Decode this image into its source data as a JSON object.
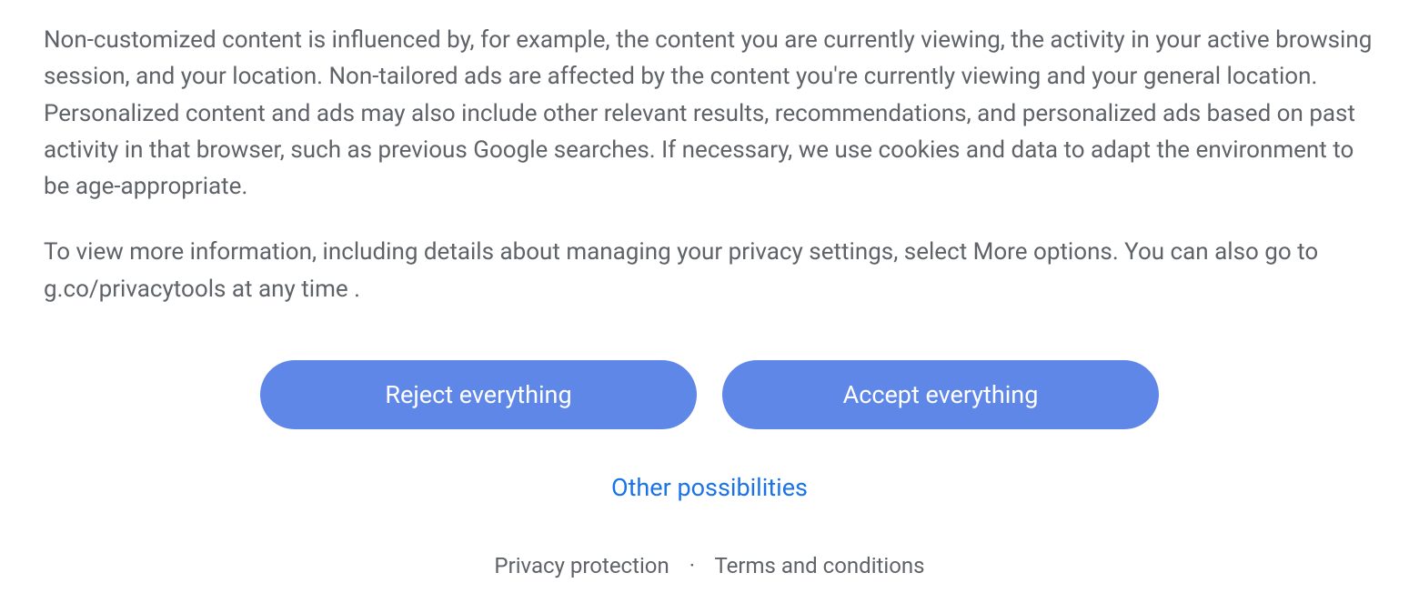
{
  "text": {
    "paragraph1": "Non-customized content is influenced by, for example, the content you are currently viewing, the activity in your active browsing session, and your location. Non-tailored ads are affected by the content you're currently viewing and your general location. Personalized content and ads may also include other relevant results, recommendations, and personalized ads based on past activity in that browser, such as previous Google searches. If necessary, we use cookies and data to adapt the environment to be age-appropriate.",
    "paragraph2": "To view more information, including details about managing your privacy settings, select More options. You can also go to g.co/privacytools at any time ."
  },
  "buttons": {
    "reject": "Reject everything",
    "accept": "Accept everything"
  },
  "links": {
    "more_options": "Other possibilities",
    "privacy": "Privacy protection",
    "terms": "Terms and conditions"
  },
  "separator": "·"
}
